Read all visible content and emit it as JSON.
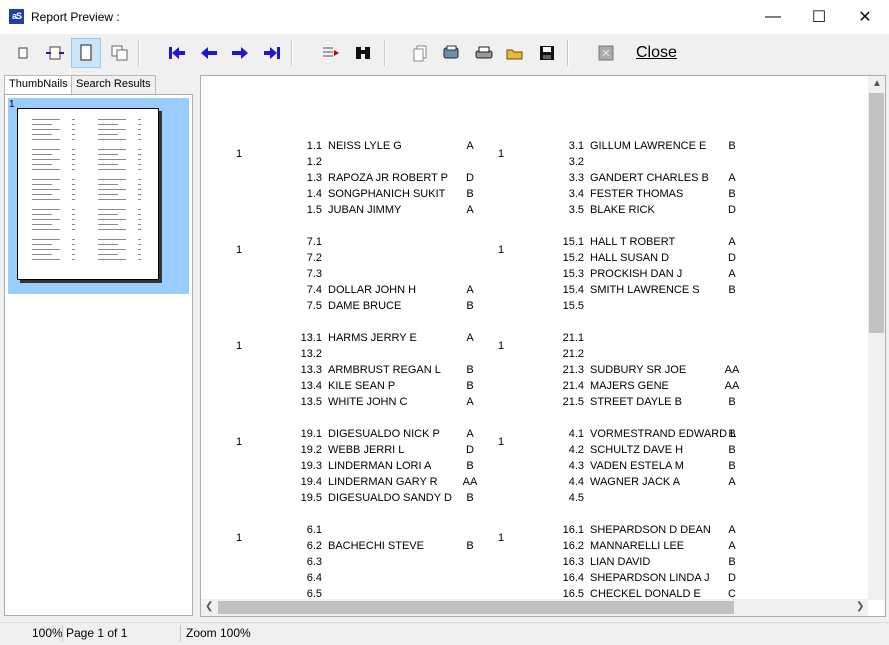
{
  "window": {
    "title": "Report Preview :",
    "app_icon": "as-logo",
    "close_label": "Close"
  },
  "toolbar": {
    "icons": [
      "single-page-icon",
      "page-width-icon",
      "whole-page-icon",
      "multi-page-icon",
      "first-page-icon",
      "prev-page-icon",
      "next-page-icon",
      "last-page-icon",
      "goto-icon",
      "find-icon",
      "copy-icon",
      "export-icon",
      "print-icon",
      "open-icon",
      "save-icon",
      "close-report-icon"
    ]
  },
  "tabs": {
    "thumbnails": "ThumbNails",
    "search": "Search Results"
  },
  "thumbnail": {
    "page_number": "1"
  },
  "status": {
    "zoom": "100%",
    "page": "Page 1 of 1",
    "zoom_label": "Zoom 100%"
  },
  "report": {
    "left": [
      {
        "num": "1",
        "rows": [
          [
            "1.1",
            "NEISS LYLE G",
            "A"
          ],
          [
            "1.2",
            "",
            ""
          ],
          [
            "1.3",
            "RAPOZA JR ROBERT P",
            "D"
          ],
          [
            "1.4",
            "SONGPHANICH SUKIT",
            "B"
          ],
          [
            "1.5",
            "JUBAN JIMMY",
            "A"
          ]
        ]
      },
      {
        "num": "1",
        "rows": [
          [
            "7.1",
            "",
            ""
          ],
          [
            "7.2",
            "",
            ""
          ],
          [
            "7.3",
            "",
            ""
          ],
          [
            "7.4",
            "DOLLAR JOHN H",
            "A"
          ],
          [
            "7.5",
            "DAME BRUCE",
            "B"
          ]
        ]
      },
      {
        "num": "1",
        "rows": [
          [
            "13.1",
            "HARMS JERRY E",
            "A"
          ],
          [
            "13.2",
            "",
            ""
          ],
          [
            "13.3",
            "ARMBRUST REGAN L",
            "B"
          ],
          [
            "13.4",
            "KILE SEAN P",
            "B"
          ],
          [
            "13.5",
            "WHITE JOHN C",
            "A"
          ]
        ]
      },
      {
        "num": "1",
        "rows": [
          [
            "19.1",
            "DIGESUALDO NICK P",
            "A"
          ],
          [
            "19.2",
            "WEBB JERRI L",
            "D"
          ],
          [
            "19.3",
            "LINDERMAN LORI A",
            "B"
          ],
          [
            "19.4",
            "LINDERMAN GARY R",
            "AA"
          ],
          [
            "19.5",
            "DIGESUALDO SANDY D",
            "B"
          ]
        ]
      },
      {
        "num": "1",
        "rows": [
          [
            "6.1",
            "",
            ""
          ],
          [
            "6.2",
            "BACHECHI STEVE",
            "B"
          ],
          [
            "6.3",
            "",
            ""
          ],
          [
            "6.4",
            "",
            ""
          ],
          [
            "6.5",
            "",
            ""
          ]
        ]
      }
    ],
    "right": [
      {
        "num": "1",
        "rows": [
          [
            "3.1",
            "GILLUM LAWRENCE E",
            "B"
          ],
          [
            "3.2",
            "",
            ""
          ],
          [
            "3.3",
            "GANDERT CHARLES B",
            "A"
          ],
          [
            "3.4",
            "FESTER THOMAS",
            "B"
          ],
          [
            "3.5",
            "BLAKE RICK",
            "D"
          ]
        ]
      },
      {
        "num": "1",
        "rows": [
          [
            "15.1",
            "HALL T ROBERT",
            "A"
          ],
          [
            "15.2",
            "HALL SUSAN D",
            "D"
          ],
          [
            "15.3",
            "PROCKISH DAN J",
            "A"
          ],
          [
            "15.4",
            "SMITH LAWRENCE S",
            "B"
          ],
          [
            "15.5",
            "",
            ""
          ]
        ]
      },
      {
        "num": "1",
        "rows": [
          [
            "21.1",
            "",
            ""
          ],
          [
            "21.2",
            "",
            ""
          ],
          [
            "21.3",
            "SUDBURY SR JOE",
            "AA"
          ],
          [
            "21.4",
            "MAJERS GENE",
            "AA"
          ],
          [
            "21.5",
            "STREET DAYLE B",
            "B"
          ]
        ]
      },
      {
        "num": "1",
        "rows": [
          [
            "4.1",
            "VORMESTRAND EDWARD L",
            "B"
          ],
          [
            "4.2",
            "SCHULTZ DAVE H",
            "B"
          ],
          [
            "4.3",
            "VADEN ESTELA M",
            "B"
          ],
          [
            "4.4",
            "WAGNER JACK A",
            "A"
          ],
          [
            "4.5",
            "",
            ""
          ]
        ]
      },
      {
        "num": "1",
        "rows": [
          [
            "16.1",
            "SHEPARDSON D DEAN",
            "A"
          ],
          [
            "16.2",
            "MANNARELLI LEE",
            "A"
          ],
          [
            "16.3",
            "LIAN DAVID",
            "B"
          ],
          [
            "16.4",
            "SHEPARDSON LINDA J",
            "D"
          ],
          [
            "16.5",
            "CHECKEL DONALD E",
            "C"
          ]
        ]
      }
    ]
  }
}
